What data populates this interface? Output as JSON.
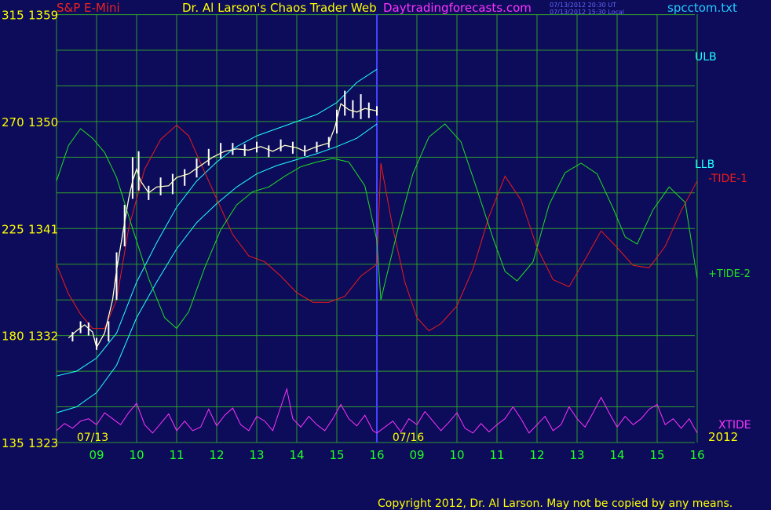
{
  "header": {
    "symbol": "S&P E-Mini",
    "title": "Dr. Al Larson's Chaos Trader Web",
    "site": "Daytradingforecasts.com",
    "stamp_ut": "07/13/2012 20:30 UT",
    "stamp_local": "07/13/2012 15:30 Local",
    "file": "spcctom.txt"
  },
  "footer": {
    "copyright": "Copyright 2012, Dr. Al Larson. May not be copied by any means."
  },
  "colors": {
    "background": "#0c0c5a",
    "grid": "#2f9a2f",
    "ulb": "#22ffff",
    "llb": "#22ffff",
    "tide1": "#ee1b1b",
    "tide2": "#22dd22",
    "xtide": "#ff33ff",
    "price": "#ffffff",
    "price_path": "#ffff00",
    "tick_labels": "#ffff00",
    "hour_labels": "#22ff22",
    "date_labels": "#ffff00",
    "vline": "#4444ff"
  },
  "chart_data": {
    "type": "line",
    "y_left_scale": [
      315,
      270,
      225,
      180,
      135
    ],
    "y_right_scale": [
      1359,
      1350,
      1341,
      1332,
      1323
    ],
    "ylim": [
      1323,
      1359
    ],
    "date_labels": [
      "07/13",
      "07/16"
    ],
    "year_label": "2012",
    "x_hour_labels": [
      "09",
      "10",
      "11",
      "12",
      "13",
      "14",
      "15",
      "16",
      "09",
      "10",
      "11",
      "12",
      "13",
      "14",
      "15",
      "16"
    ],
    "series_labels": {
      "ulb": "ULB",
      "llb": "LLB",
      "tide1": "-TIDE-1",
      "tide2": "+TIDE-2",
      "xtide": "XTIDE"
    },
    "price_close": [
      [
        8.3,
        1331.8
      ],
      [
        8.5,
        1332.4
      ],
      [
        8.7,
        1332.9
      ],
      [
        8.9,
        1332.3
      ],
      [
        9.0,
        1331.0
      ],
      [
        9.2,
        1332.2
      ],
      [
        9.4,
        1335.0
      ],
      [
        9.5,
        1337.5
      ],
      [
        9.6,
        1339.5
      ],
      [
        9.7,
        1341.5
      ],
      [
        9.8,
        1343.5
      ],
      [
        9.9,
        1345.0
      ],
      [
        10.0,
        1346.0
      ],
      [
        10.1,
        1345.0
      ],
      [
        10.3,
        1344.0
      ],
      [
        10.5,
        1344.5
      ],
      [
        10.8,
        1344.6
      ],
      [
        11.0,
        1345.3
      ],
      [
        11.3,
        1345.6
      ],
      [
        11.6,
        1346.3
      ],
      [
        11.9,
        1347.0
      ],
      [
        12.2,
        1347.5
      ],
      [
        12.5,
        1347.7
      ],
      [
        12.8,
        1347.6
      ],
      [
        13.1,
        1347.9
      ],
      [
        13.4,
        1347.5
      ],
      [
        13.7,
        1348.0
      ],
      [
        14.0,
        1347.8
      ],
      [
        14.2,
        1347.5
      ],
      [
        14.5,
        1347.9
      ],
      [
        14.8,
        1348.2
      ],
      [
        14.95,
        1349.5
      ],
      [
        15.1,
        1351.5
      ],
      [
        15.3,
        1351.0
      ],
      [
        15.5,
        1350.8
      ],
      [
        15.7,
        1351.1
      ],
      [
        16.0,
        1350.9
      ]
    ],
    "price_hilo": [
      [
        8.4,
        1331.5,
        1332.3
      ],
      [
        8.6,
        1332.2,
        1333.2
      ],
      [
        8.8,
        1332.0,
        1333.1
      ],
      [
        9.0,
        1330.8,
        1331.8
      ],
      [
        9.3,
        1331.5,
        1333.2
      ],
      [
        9.5,
        1335.0,
        1339.0
      ],
      [
        9.7,
        1339.5,
        1343.0
      ],
      [
        9.9,
        1343.5,
        1347.0
      ],
      [
        10.05,
        1344.2,
        1347.5
      ],
      [
        10.3,
        1343.4,
        1344.6
      ],
      [
        10.6,
        1343.8,
        1345.3
      ],
      [
        10.9,
        1343.9,
        1345.6
      ],
      [
        11.2,
        1344.6,
        1346.0
      ],
      [
        11.5,
        1345.3,
        1346.9
      ],
      [
        11.8,
        1346.3,
        1347.7
      ],
      [
        12.1,
        1346.9,
        1348.2
      ],
      [
        12.4,
        1347.2,
        1348.2
      ],
      [
        12.7,
        1347.1,
        1348.1
      ],
      [
        13.0,
        1347.4,
        1348.3
      ],
      [
        13.3,
        1347.0,
        1348.0
      ],
      [
        13.6,
        1347.5,
        1348.5
      ],
      [
        13.9,
        1347.3,
        1348.3
      ],
      [
        14.2,
        1347.1,
        1348.0
      ],
      [
        14.5,
        1347.4,
        1348.3
      ],
      [
        14.8,
        1347.8,
        1348.7
      ],
      [
        15.0,
        1349.0,
        1351.0
      ],
      [
        15.2,
        1350.5,
        1352.6
      ],
      [
        15.4,
        1350.3,
        1351.8
      ],
      [
        15.6,
        1350.2,
        1352.3
      ],
      [
        15.8,
        1350.3,
        1351.6
      ],
      [
        16.0,
        1350.5,
        1351.3
      ]
    ],
    "ulb": [
      [
        8.0,
        1328.6
      ],
      [
        8.5,
        1329.0
      ],
      [
        9.0,
        1330.1
      ],
      [
        9.5,
        1332.2
      ],
      [
        10.0,
        1336.5
      ],
      [
        10.5,
        1339.8
      ],
      [
        11.0,
        1342.8
      ],
      [
        11.5,
        1345.0
      ],
      [
        12.0,
        1346.6
      ],
      [
        12.5,
        1347.9
      ],
      [
        13.0,
        1348.8
      ],
      [
        13.5,
        1349.4
      ],
      [
        14.0,
        1350.0
      ],
      [
        14.5,
        1350.6
      ],
      [
        15.0,
        1351.6
      ],
      [
        15.5,
        1353.3
      ],
      [
        16.0,
        1354.4
      ]
    ],
    "llb": [
      [
        8.0,
        1325.5
      ],
      [
        8.5,
        1326.0
      ],
      [
        9.0,
        1327.2
      ],
      [
        9.5,
        1329.5
      ],
      [
        10.0,
        1333.5
      ],
      [
        10.5,
        1336.5
      ],
      [
        11.0,
        1339.3
      ],
      [
        11.5,
        1341.5
      ],
      [
        12.0,
        1343.1
      ],
      [
        12.5,
        1344.5
      ],
      [
        13.0,
        1345.6
      ],
      [
        13.5,
        1346.3
      ],
      [
        14.0,
        1346.8
      ],
      [
        14.5,
        1347.3
      ],
      [
        15.0,
        1347.9
      ],
      [
        15.5,
        1348.6
      ],
      [
        16.0,
        1349.8
      ]
    ],
    "tide1": [
      [
        8.0,
        1338.0
      ],
      [
        8.3,
        1335.5
      ],
      [
        8.6,
        1333.8
      ],
      [
        8.9,
        1332.6
      ],
      [
        9.2,
        1332.6
      ],
      [
        9.5,
        1335.0
      ],
      [
        9.8,
        1341.0
      ],
      [
        10.2,
        1346.0
      ],
      [
        10.6,
        1348.5
      ],
      [
        11.0,
        1349.7
      ],
      [
        11.3,
        1348.8
      ],
      [
        11.6,
        1346.5
      ],
      [
        12.0,
        1343.5
      ],
      [
        12.4,
        1340.5
      ],
      [
        12.8,
        1338.7
      ],
      [
        13.2,
        1338.2
      ],
      [
        13.6,
        1337.0
      ],
      [
        14.0,
        1335.6
      ],
      [
        14.4,
        1334.8
      ],
      [
        14.8,
        1334.8
      ],
      [
        15.2,
        1335.3
      ],
      [
        15.6,
        1337.0
      ],
      [
        16.0,
        1338.0
      ],
      [
        16.1,
        1346.5
      ],
      [
        16.4,
        1341.0
      ],
      [
        16.7,
        1336.5
      ],
      [
        17.0,
        1333.5
      ],
      [
        17.3,
        1332.4
      ],
      [
        17.6,
        1333.0
      ],
      [
        18.0,
        1334.5
      ],
      [
        18.4,
        1337.6
      ],
      [
        18.8,
        1342.0
      ],
      [
        19.2,
        1345.4
      ],
      [
        19.6,
        1343.4
      ],
      [
        20.0,
        1339.4
      ],
      [
        20.4,
        1336.7
      ],
      [
        20.8,
        1336.1
      ],
      [
        21.2,
        1338.4
      ],
      [
        21.6,
        1340.8
      ],
      [
        22.0,
        1339.4
      ],
      [
        22.4,
        1337.9
      ],
      [
        22.8,
        1337.7
      ],
      [
        23.2,
        1339.5
      ],
      [
        23.6,
        1342.5
      ],
      [
        24.0,
        1345.0
      ]
    ],
    "tide2": [
      [
        8.0,
        1345.0
      ],
      [
        8.3,
        1348.0
      ],
      [
        8.6,
        1349.4
      ],
      [
        8.9,
        1348.6
      ],
      [
        9.2,
        1347.4
      ],
      [
        9.5,
        1345.3
      ],
      [
        9.9,
        1341.0
      ],
      [
        10.3,
        1336.8
      ],
      [
        10.7,
        1333.5
      ],
      [
        11.0,
        1332.6
      ],
      [
        11.3,
        1334.0
      ],
      [
        11.7,
        1337.7
      ],
      [
        12.1,
        1340.9
      ],
      [
        12.5,
        1343.0
      ],
      [
        12.9,
        1344.1
      ],
      [
        13.3,
        1344.5
      ],
      [
        13.7,
        1345.4
      ],
      [
        14.1,
        1346.2
      ],
      [
        14.5,
        1346.6
      ],
      [
        14.9,
        1346.9
      ],
      [
        15.3,
        1346.6
      ],
      [
        15.7,
        1344.6
      ],
      [
        16.0,
        1340.0
      ],
      [
        16.1,
        1335.0
      ],
      [
        16.5,
        1340.6
      ],
      [
        16.9,
        1345.6
      ],
      [
        17.3,
        1348.7
      ],
      [
        17.7,
        1349.8
      ],
      [
        18.1,
        1348.3
      ],
      [
        18.5,
        1344.3
      ],
      [
        18.9,
        1340.2
      ],
      [
        19.2,
        1337.4
      ],
      [
        19.5,
        1336.6
      ],
      [
        19.9,
        1338.2
      ],
      [
        20.3,
        1343.0
      ],
      [
        20.7,
        1345.7
      ],
      [
        21.1,
        1346.5
      ],
      [
        21.5,
        1345.6
      ],
      [
        21.9,
        1342.7
      ],
      [
        22.2,
        1340.3
      ],
      [
        22.5,
        1339.7
      ],
      [
        22.9,
        1342.6
      ],
      [
        23.3,
        1344.5
      ],
      [
        23.7,
        1343.2
      ],
      [
        24.0,
        1336.8
      ]
    ],
    "xtide": [
      [
        8.0,
        1324.0
      ],
      [
        8.2,
        1324.6
      ],
      [
        8.4,
        1324.2
      ],
      [
        8.6,
        1324.8
      ],
      [
        8.8,
        1325.0
      ],
      [
        9.0,
        1324.5
      ],
      [
        9.2,
        1325.5
      ],
      [
        9.4,
        1325.0
      ],
      [
        9.6,
        1324.5
      ],
      [
        9.8,
        1325.5
      ],
      [
        10.0,
        1326.3
      ],
      [
        10.2,
        1324.5
      ],
      [
        10.4,
        1323.8
      ],
      [
        10.6,
        1324.6
      ],
      [
        10.8,
        1325.4
      ],
      [
        11.0,
        1324.0
      ],
      [
        11.2,
        1324.8
      ],
      [
        11.4,
        1324.0
      ],
      [
        11.6,
        1324.3
      ],
      [
        11.8,
        1325.8
      ],
      [
        12.0,
        1324.4
      ],
      [
        12.2,
        1325.3
      ],
      [
        12.4,
        1325.9
      ],
      [
        12.6,
        1324.5
      ],
      [
        12.8,
        1324.0
      ],
      [
        13.0,
        1325.2
      ],
      [
        13.2,
        1324.8
      ],
      [
        13.4,
        1324.0
      ],
      [
        13.6,
        1326.0
      ],
      [
        13.75,
        1327.5
      ],
      [
        13.9,
        1325.0
      ],
      [
        14.1,
        1324.3
      ],
      [
        14.3,
        1325.2
      ],
      [
        14.5,
        1324.5
      ],
      [
        14.7,
        1324.0
      ],
      [
        14.9,
        1325.0
      ],
      [
        15.1,
        1326.2
      ],
      [
        15.3,
        1325.0
      ],
      [
        15.5,
        1324.4
      ],
      [
        15.7,
        1325.3
      ],
      [
        15.9,
        1324.0
      ],
      [
        16.0,
        1323.8
      ],
      [
        16.2,
        1324.3
      ],
      [
        16.4,
        1324.8
      ],
      [
        16.6,
        1323.9
      ],
      [
        16.8,
        1325.0
      ],
      [
        17.0,
        1324.5
      ],
      [
        17.2,
        1325.6
      ],
      [
        17.4,
        1324.8
      ],
      [
        17.6,
        1324.0
      ],
      [
        17.8,
        1324.7
      ],
      [
        18.0,
        1325.5
      ],
      [
        18.2,
        1324.2
      ],
      [
        18.4,
        1323.8
      ],
      [
        18.6,
        1324.6
      ],
      [
        18.8,
        1323.9
      ],
      [
        19.0,
        1324.5
      ],
      [
        19.2,
        1325.0
      ],
      [
        19.4,
        1326.0
      ],
      [
        19.6,
        1325.0
      ],
      [
        19.8,
        1323.8
      ],
      [
        20.0,
        1324.5
      ],
      [
        20.2,
        1325.2
      ],
      [
        20.4,
        1324.0
      ],
      [
        20.6,
        1324.5
      ],
      [
        20.8,
        1326.0
      ],
      [
        21.0,
        1325.0
      ],
      [
        21.2,
        1324.3
      ],
      [
        21.4,
        1325.5
      ],
      [
        21.6,
        1326.8
      ],
      [
        21.8,
        1325.5
      ],
      [
        22.0,
        1324.3
      ],
      [
        22.2,
        1325.2
      ],
      [
        22.4,
        1324.5
      ],
      [
        22.6,
        1325.0
      ],
      [
        22.8,
        1325.8
      ],
      [
        23.0,
        1326.2
      ],
      [
        23.2,
        1324.5
      ],
      [
        23.4,
        1325.0
      ],
      [
        23.6,
        1324.2
      ],
      [
        23.8,
        1325.0
      ],
      [
        24.0,
        1323.8
      ]
    ]
  }
}
